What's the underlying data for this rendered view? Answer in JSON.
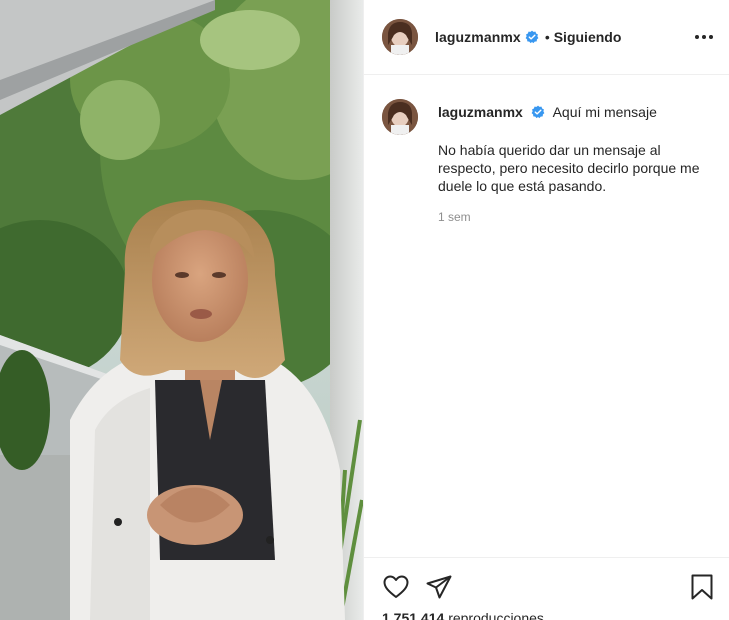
{
  "post": {
    "author": {
      "username": "laguzmanmx",
      "verified": true
    },
    "header": {
      "separator": "•",
      "follow_status": "Siguiendo"
    },
    "caption": {
      "title": "Aquí mi mensaje",
      "text": "No había querido dar un mensaje al respecto, pero necesito decirlo porque me duele lo que está pasando.",
      "time_ago": "1 sem"
    },
    "stats": {
      "views_count": "1.751.414",
      "views_label": "reproducciones"
    }
  },
  "icons": {
    "verified": "verified-badge-icon",
    "more": "more-options-icon",
    "like": "heart-icon",
    "share": "paper-plane-icon",
    "save": "bookmark-icon"
  },
  "colors": {
    "verified_blue": "#3897f0",
    "text": "#262626",
    "muted": "#8e8e8e",
    "divider": "#efefef"
  }
}
